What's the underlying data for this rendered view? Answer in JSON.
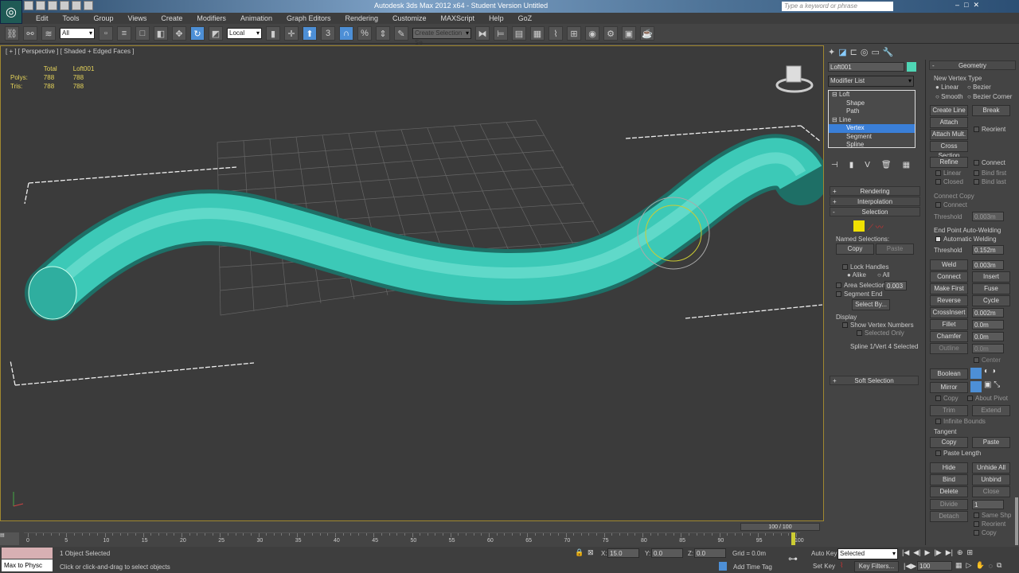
{
  "app": {
    "title": "Autodesk 3ds Max 2012 x64 - Student Version   Untitled",
    "search_placeholder": "Type a keyword or phrase"
  },
  "menu": [
    "Edit",
    "Tools",
    "Group",
    "Views",
    "Create",
    "Modifiers",
    "Animation",
    "Graph Editors",
    "Rendering",
    "Customize",
    "MAXScript",
    "Help",
    "GoZ"
  ],
  "toolbar": {
    "filter": "All",
    "coord_system": "Local",
    "selection_set": "Create Selection Se",
    "snap_angle": "3"
  },
  "viewport": {
    "label": "[ + ] [ Perspective ] [ Shaded + Edged Faces ]",
    "stats": {
      "h1": "Total",
      "h2": "Loft001",
      "rows": [
        {
          "k": "Polys:",
          "a": "788",
          "b": "788"
        },
        {
          "k": "Tris:",
          "a": "788",
          "b": "788"
        }
      ]
    },
    "tube_color": "#3cc9b7"
  },
  "cmd": {
    "object_name": "Loft001",
    "object_color": "#4fd6b5",
    "modifier_list": "Modifier List",
    "stack": [
      {
        "label": "Loft",
        "level": 0,
        "box": "⊟"
      },
      {
        "label": "Shape",
        "level": 1
      },
      {
        "label": "Path",
        "level": 1
      },
      {
        "label": "Line",
        "level": 0,
        "box": "⊟"
      },
      {
        "label": "Vertex",
        "level": 1,
        "selected": true
      },
      {
        "label": "Segment",
        "level": 1
      },
      {
        "label": "Spline",
        "level": 1
      }
    ],
    "rollouts": {
      "rendering": "Rendering",
      "interpolation": "Interpolation",
      "selection": "Selection",
      "soft": "Soft Selection"
    },
    "named_sel": "Named Selections:",
    "copy": "Copy",
    "paste": "Paste",
    "lock_handles": "Lock Handles",
    "alike": "Alike",
    "all": "All",
    "area_sel": "Area Selection:",
    "area_val": "0.003",
    "seg_end": "Segment End",
    "select_by": "Select By...",
    "display": "Display",
    "show_vnums": "Show Vertex Numbers",
    "sel_only": "Selected Only",
    "sel_status": "Spline 1/Vert 4 Selected"
  },
  "geometry": {
    "title": "Geometry",
    "nvt": "New Vertex Type",
    "linear": "Linear",
    "bezier": "Bezier",
    "smooth": "Smooth",
    "bezier_corner": "Bezier Corner",
    "create_line": "Create Line",
    "break": "Break",
    "attach": "Attach",
    "reorient": "Reorient",
    "attach_mult": "Attach Mult.",
    "cross_section": "Cross Section",
    "refine": "Refine",
    "connect": "Connect",
    "linear2": "Linear",
    "bind_first": "Bind first",
    "closed": "Closed",
    "bind_last": "Bind last",
    "connect_copy": "Connect Copy",
    "connect2": "Connect",
    "threshold": "Threshold",
    "threshold_val": "0.003m",
    "end_weld": "End Point Auto-Welding",
    "auto_weld": "Automatic Welding",
    "threshold2_val": "0.152m",
    "weld": "Weld",
    "weld_val": "0.003m",
    "connect3": "Connect",
    "insert": "Insert",
    "make_first": "Make First",
    "fuse": "Fuse",
    "reverse": "Reverse",
    "cycle": "Cycle",
    "crossinsert": "CrossInsert",
    "crossinsert_val": "0.002m",
    "fillet": "Fillet",
    "fillet_val": "0.0m",
    "chamfer": "Chamfer",
    "chamfer_val": "0.0m",
    "outline": "Outline",
    "outline_val": "0.0m",
    "center": "Center",
    "boolean": "Boolean",
    "mirror": "Mirror",
    "copy": "Copy",
    "about_pivot": "About Pivot",
    "trim": "Trim",
    "extend": "Extend",
    "infinite": "Infinite Bounds",
    "tangent": "Tangent",
    "t_copy": "Copy",
    "t_paste": "Paste",
    "paste_len": "Paste Length",
    "hide": "Hide",
    "unhide_all": "Unhide All",
    "bind": "Bind",
    "unbind": "Unbind",
    "delete": "Delete",
    "close": "Close",
    "divide": "Divide",
    "divide_val": "1",
    "detach": "Detach",
    "same_shp": "Same Shp",
    "reorient2": "Reorient",
    "copy2": "Copy"
  },
  "timeline": {
    "frame": "100 / 100",
    "ticks": [
      "0",
      "5",
      "10",
      "15",
      "20",
      "25",
      "30",
      "35",
      "40",
      "45",
      "50",
      "55",
      "60",
      "65",
      "70",
      "75",
      "80",
      "85",
      "90",
      "95",
      "100"
    ]
  },
  "status": {
    "maxscript": "Max to Physc",
    "selected": "1 Object Selected",
    "prompt": "Click or click-and-drag to select objects",
    "x": "15.0",
    "y": "0.0",
    "z": "0.0",
    "grid": "Grid = 0.0m",
    "add_time_tag": "Add Time Tag",
    "auto_key": "Auto Key",
    "set_key": "Set Key",
    "key_mode": "Selected",
    "key_filters": "Key Filters...",
    "frame": "100"
  }
}
